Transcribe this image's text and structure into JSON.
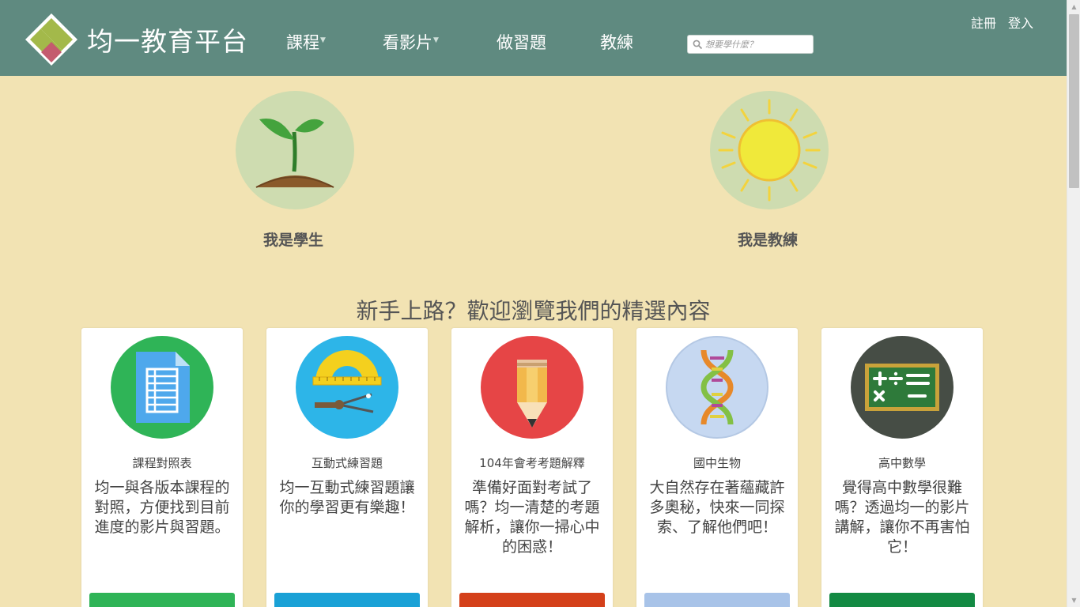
{
  "header": {
    "logo_text": "均一教育平台",
    "nav": [
      {
        "label": "課程",
        "has_caret": true
      },
      {
        "label": "看影片",
        "has_caret": true
      },
      {
        "label": "做習題",
        "has_caret": false
      },
      {
        "label": "教練",
        "has_caret": false
      }
    ],
    "search_placeholder": "想要學什麼？",
    "register_label": "註冊",
    "login_label": "登入",
    "colors": {
      "bar": "#5f8a80",
      "logo_green": "#a3b94a",
      "logo_red": "#c45b6e"
    }
  },
  "roles": {
    "student_label": "我是學生",
    "coach_label": "我是教練"
  },
  "featured": {
    "title": "新手上路？歡迎瀏覽我們的精選內容",
    "cards": [
      {
        "title": "課程對照表",
        "description": "均一與各版本課程的對照，方便找到目前進度的影片與習題。",
        "icon": "document-icon",
        "color": "#2fb457"
      },
      {
        "title": "互動式練習題",
        "description": "均一互動式練習題讓你的學習更有樂趣！",
        "icon": "protractor-compass-icon",
        "color": "#1aa1d6"
      },
      {
        "title": "104年會考考題解釋",
        "description": "準備好面對考試了嗎？均一清楚的考題解析，讓你一掃心中的困惑！",
        "icon": "pencil-icon",
        "color": "#d4401a"
      },
      {
        "title": "國中生物",
        "description": "大自然存在著蘊藏許多奧秘，快來一同探索、了解他們吧！",
        "icon": "dna-icon",
        "color": "#a8c3e8"
      },
      {
        "title": "高中數學",
        "description": "覺得高中數學很難嗎？透過均一的影片講解，讓你不再害怕它！",
        "icon": "math-board-icon",
        "color": "#138a43"
      }
    ]
  }
}
